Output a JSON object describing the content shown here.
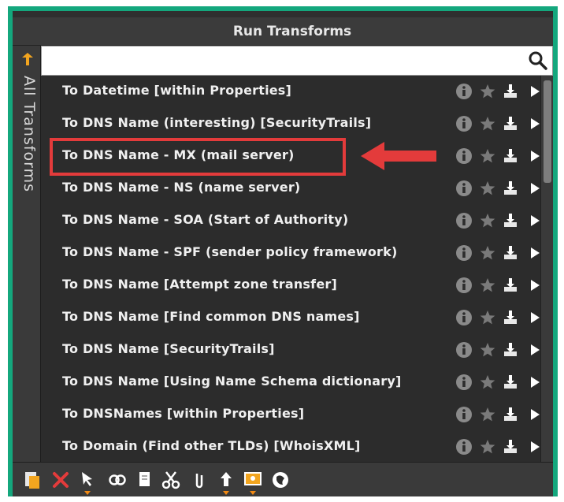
{
  "window": {
    "title": "Run Transforms"
  },
  "sidebar": {
    "back_label": "↰",
    "label": "All Transforms"
  },
  "search": {
    "value": "",
    "placeholder": ""
  },
  "transforms": [
    {
      "label": "To Datetime [within Properties]"
    },
    {
      "label": "To DNS Name (interesting) [SecurityTrails]"
    },
    {
      "label": "To DNS Name - MX (mail server)"
    },
    {
      "label": "To DNS Name - NS (name server)"
    },
    {
      "label": "To DNS Name - SOA (Start of Authority)"
    },
    {
      "label": "To DNS Name - SPF (sender policy framework)"
    },
    {
      "label": "To DNS Name [Attempt zone transfer]"
    },
    {
      "label": "To DNS Name [Find common DNS names]"
    },
    {
      "label": "To DNS Name [SecurityTrails]"
    },
    {
      "label": "To DNS Name [Using Name Schema dictionary]"
    },
    {
      "label": "To DNSNames [within Properties]"
    },
    {
      "label": "To Domain (Find other TLDs) [WhoisXML]"
    }
  ],
  "row_actions": [
    "info-icon",
    "star-icon",
    "download-icon",
    "play-icon"
  ],
  "toolbar": {
    "icons": [
      "paste-icon",
      "delete-icon",
      "select-icon",
      "link-icon",
      "copy-icon",
      "cut-icon",
      "attach-icon",
      "upload-icon",
      "screen-icon",
      "globe-icon"
    ]
  },
  "annotation": {
    "highlighted_row": "To DNS Name - MX (mail server)"
  },
  "colors": {
    "border": "#14a77d",
    "accent_orange": "#f2a51f",
    "annotation_red": "#e33b3b",
    "panel": "#2c2c2c"
  }
}
